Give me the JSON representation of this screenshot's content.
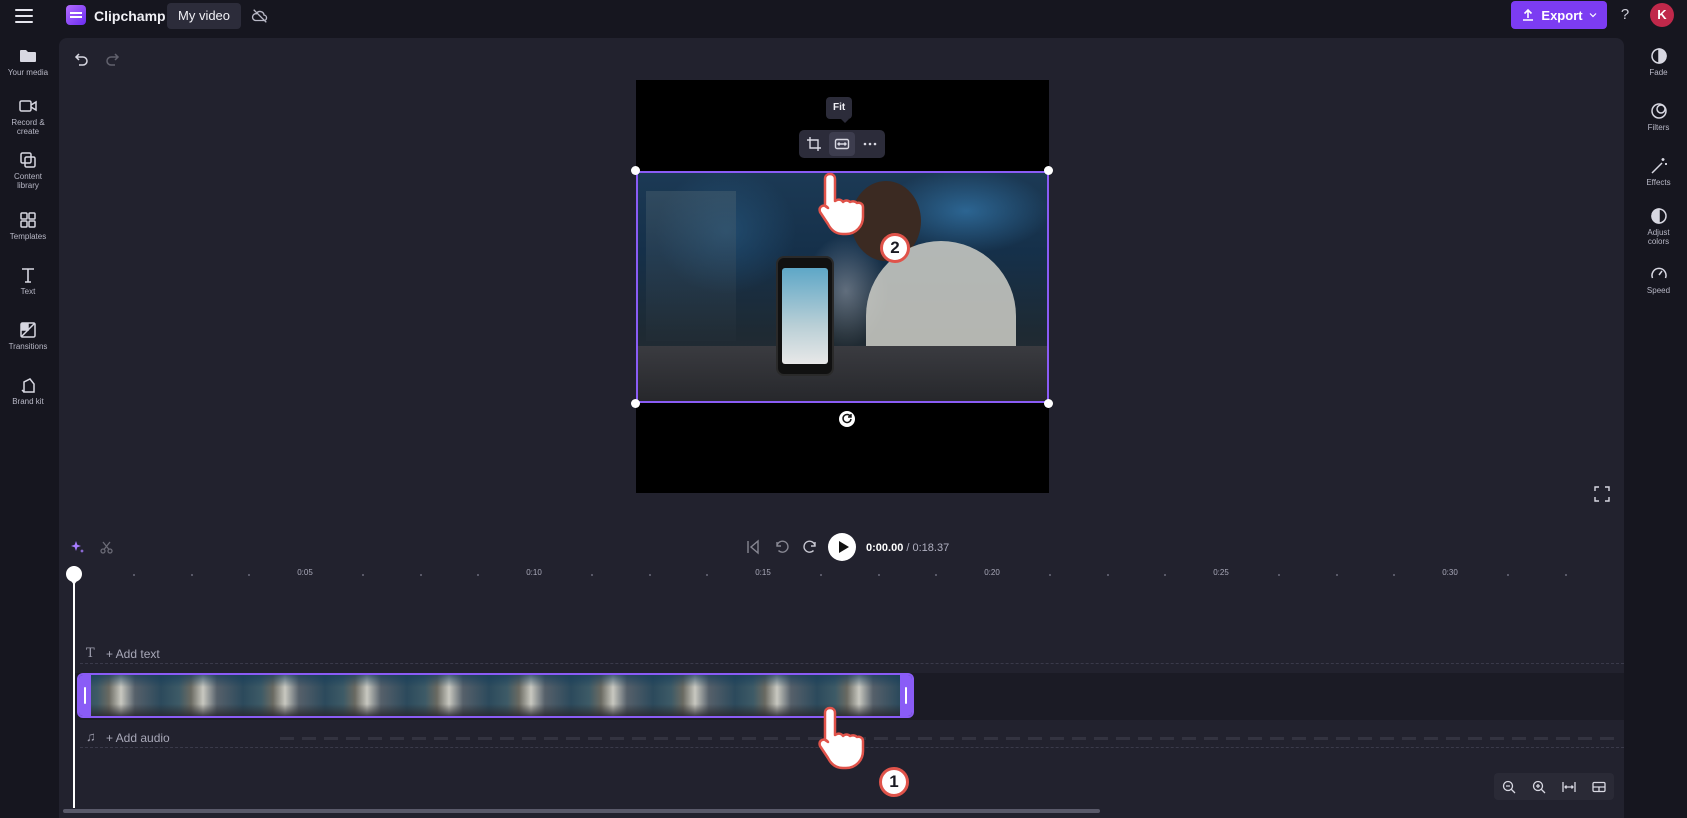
{
  "topbar": {
    "app_name": "Clipchamp",
    "project_title": "My video",
    "export_label": "Export",
    "help_label": "?",
    "avatar_initial": "K"
  },
  "left_sidebar": {
    "items": [
      {
        "label": "Your media",
        "icon": "folder-icon"
      },
      {
        "label": "Record & create",
        "icon": "camera-icon"
      },
      {
        "label": "Content library",
        "icon": "library-icon"
      },
      {
        "label": "Templates",
        "icon": "templates-icon"
      },
      {
        "label": "Text",
        "icon": "text-icon"
      },
      {
        "label": "Transitions",
        "icon": "transitions-icon"
      },
      {
        "label": "Brand kit",
        "icon": "brand-kit-icon"
      }
    ]
  },
  "right_sidebar": {
    "items": [
      {
        "label": "Fade",
        "icon": "fade-icon"
      },
      {
        "label": "Filters",
        "icon": "filters-icon"
      },
      {
        "label": "Effects",
        "icon": "effects-icon"
      },
      {
        "label": "Adjust colors",
        "icon": "adjust-colors-icon"
      },
      {
        "label": "Speed",
        "icon": "speed-icon"
      }
    ]
  },
  "preview": {
    "tooltip": "Fit"
  },
  "playback": {
    "current_time": "0:00.00",
    "separator": " / ",
    "total_time": "0:18.37"
  },
  "ruler": {
    "labels": [
      "0:05",
      "0:10",
      "0:15",
      "0:20",
      "0:25",
      "0:30"
    ]
  },
  "timeline": {
    "add_text": "+ Add text",
    "add_audio": "+ Add audio"
  },
  "annotations": {
    "step_1": "1",
    "step_2": "2"
  },
  "colors": {
    "accent": "#7c3cf2",
    "selection": "#8a5cf6",
    "badge_border": "#e0534a",
    "avatar": "#c0284a"
  }
}
